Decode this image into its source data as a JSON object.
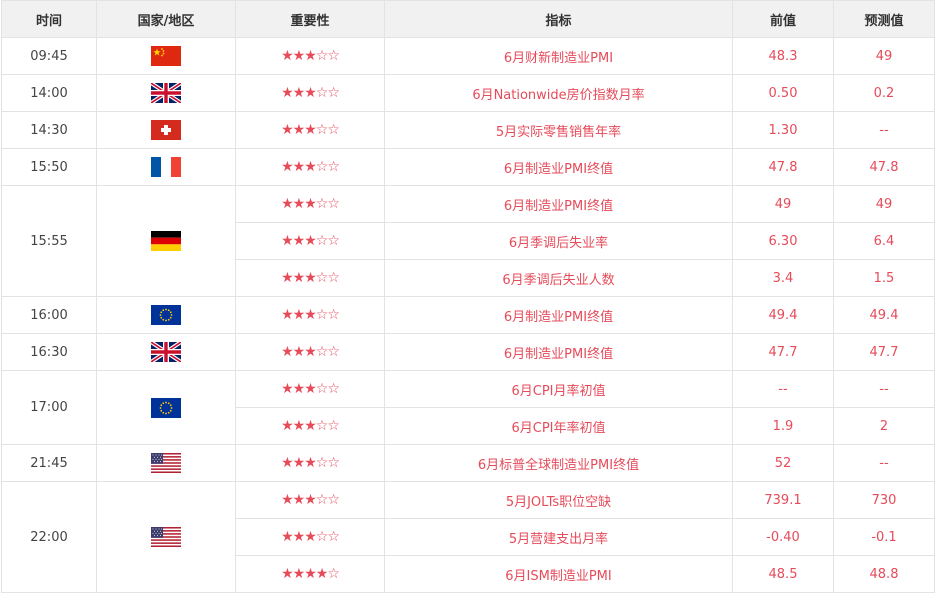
{
  "headers": {
    "time": "时间",
    "country": "国家/地区",
    "importance": "重要性",
    "indicator": "指标",
    "previous": "前值",
    "forecast": "预测值"
  },
  "colors": {
    "accent": "#e64b5a",
    "header_bg": "#f1f1f1",
    "border": "#e3e3e3"
  },
  "rows": [
    {
      "time": "09:45",
      "flag": "china-flag-icon",
      "stars": 3,
      "indicator": "6月财新制造业PMI",
      "previous": "48.3",
      "forecast": "49"
    },
    {
      "time": "14:00",
      "flag": "uk-flag-icon",
      "stars": 3,
      "indicator": "6月Nationwide房价指数月率",
      "previous": "0.50",
      "forecast": "0.2"
    },
    {
      "time": "14:30",
      "flag": "switzerland-flag-icon",
      "stars": 3,
      "indicator": "5月实际零售销售年率",
      "previous": "1.30",
      "forecast": "--"
    },
    {
      "time": "15:50",
      "flag": "france-flag-icon",
      "stars": 3,
      "indicator": "6月制造业PMI终值",
      "previous": "47.8",
      "forecast": "47.8"
    },
    {
      "time": "15:55",
      "flag": "germany-flag-icon",
      "stars": 3,
      "indicator": "6月制造业PMI终值",
      "previous": "49",
      "forecast": "49"
    },
    {
      "stars": 3,
      "indicator": "6月季调后失业率",
      "previous": "6.30",
      "forecast": "6.4"
    },
    {
      "stars": 3,
      "indicator": "6月季调后失业人数",
      "previous": "3.4",
      "forecast": "1.5"
    },
    {
      "time": "16:00",
      "flag": "eu-flag-icon",
      "stars": 3,
      "indicator": "6月制造业PMI终值",
      "previous": "49.4",
      "forecast": "49.4"
    },
    {
      "time": "16:30",
      "flag": "uk-flag-icon",
      "stars": 3,
      "indicator": "6月制造业PMI终值",
      "previous": "47.7",
      "forecast": "47.7"
    },
    {
      "time": "17:00",
      "flag": "eu-flag-icon",
      "stars": 3,
      "indicator": "6月CPI月率初值",
      "previous": "--",
      "forecast": "--"
    },
    {
      "stars": 3,
      "indicator": "6月CPI年率初值",
      "previous": "1.9",
      "forecast": "2"
    },
    {
      "time": "21:45",
      "flag": "us-flag-icon",
      "stars": 3,
      "indicator": "6月标普全球制造业PMI终值",
      "previous": "52",
      "forecast": "--"
    },
    {
      "time": "22:00",
      "flag": "us-flag-icon",
      "stars": 3,
      "indicator": "5月JOLTs职位空缺",
      "previous": "739.1",
      "forecast": "730"
    },
    {
      "stars": 3,
      "indicator": "5月营建支出月率",
      "previous": "-0.40",
      "forecast": "-0.1"
    },
    {
      "stars": 4,
      "indicator": "6月ISM制造业PMI",
      "previous": "48.5",
      "forecast": "48.8"
    }
  ]
}
